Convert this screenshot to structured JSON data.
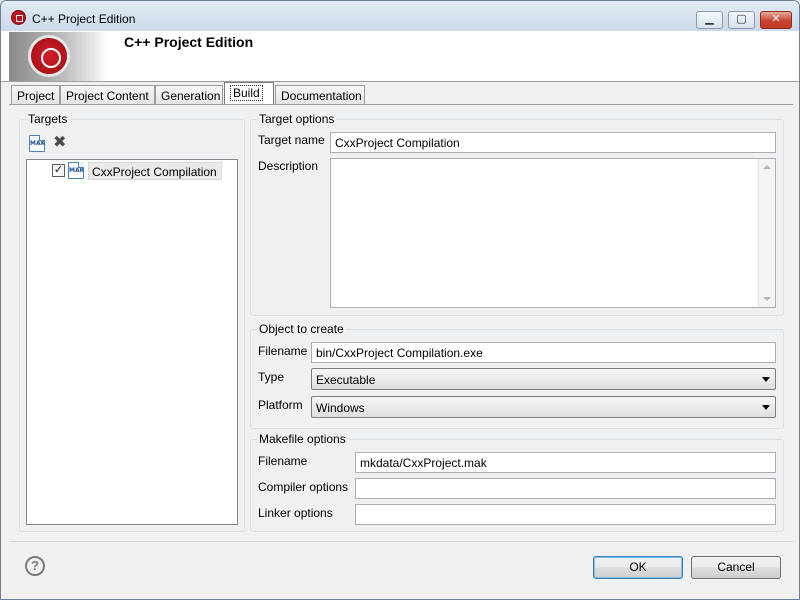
{
  "window": {
    "title": "C++ Project Edition",
    "controls": {
      "minimize": "▁",
      "maximize": "▢",
      "close": "✕"
    }
  },
  "header": {
    "title": "C++ Project Edition"
  },
  "tabs": [
    {
      "label": "Project"
    },
    {
      "label": "Project Content"
    },
    {
      "label": "Generation"
    },
    {
      "label": "Build",
      "active": true
    },
    {
      "label": "Documentation"
    }
  ],
  "targets": {
    "group_label": "Targets",
    "toolbar": {
      "add_icon_text": "MAK",
      "delete_icon": "✖"
    },
    "items": [
      {
        "label": "CxxProject Compilation",
        "checked": true,
        "check_glyph": "✓",
        "icon_text": "MAK"
      }
    ]
  },
  "target_options": {
    "group_label": "Target options",
    "target_name_label": "Target name",
    "target_name_value": "CxxProject Compilation",
    "description_label": "Description",
    "description_value": ""
  },
  "object_to_create": {
    "group_label": "Object to create",
    "filename_label": "Filename",
    "filename_value": "bin/CxxProject Compilation.exe",
    "type_label": "Type",
    "type_value": "Executable",
    "platform_label": "Platform",
    "platform_value": "Windows"
  },
  "makefile_options": {
    "group_label": "Makefile options",
    "filename_label": "Filename",
    "filename_value": "mkdata/CxxProject.mak",
    "compiler_label": "Compiler options",
    "compiler_value": "",
    "linker_label": "Linker options",
    "linker_value": ""
  },
  "footer": {
    "help_glyph": "?",
    "ok_label": "OK",
    "cancel_label": "Cancel"
  },
  "colors": {
    "close_button": "#c9442f",
    "brand_red": "#b4141c",
    "default_button_border": "#3c7fb1"
  }
}
